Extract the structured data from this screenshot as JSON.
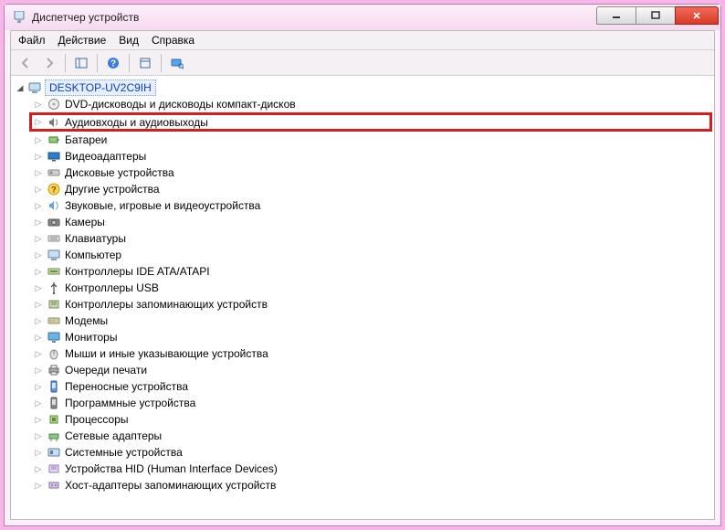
{
  "window": {
    "title": "Диспетчер устройств"
  },
  "menu": {
    "file": "Файл",
    "action": "Действие",
    "view": "Вид",
    "help": "Справка"
  },
  "tree": {
    "root_label": "DESKTOP-UV2C9IH",
    "items": [
      {
        "label": "DVD-дисководы и дисководы компакт-дисков",
        "icon": "disc-icon"
      },
      {
        "label": "Аудиовходы и аудиовыходы",
        "icon": "speaker-icon",
        "highlight": true
      },
      {
        "label": "Батареи",
        "icon": "battery-icon"
      },
      {
        "label": "Видеоадаптеры",
        "icon": "display-adapter-icon"
      },
      {
        "label": "Дисковые устройства",
        "icon": "drive-icon"
      },
      {
        "label": "Другие устройства",
        "icon": "question-icon"
      },
      {
        "label": "Звуковые, игровые и видеоустройства",
        "icon": "sound-icon"
      },
      {
        "label": "Камеры",
        "icon": "camera-icon"
      },
      {
        "label": "Клавиатуры",
        "icon": "keyboard-icon"
      },
      {
        "label": "Компьютер",
        "icon": "computer-icon"
      },
      {
        "label": "Контроллеры IDE ATA/ATAPI",
        "icon": "ide-icon"
      },
      {
        "label": "Контроллеры USB",
        "icon": "usb-icon"
      },
      {
        "label": "Контроллеры запоминающих устройств",
        "icon": "storage-controller-icon"
      },
      {
        "label": "Модемы",
        "icon": "modem-icon"
      },
      {
        "label": "Мониторы",
        "icon": "monitor-icon"
      },
      {
        "label": "Мыши и иные указывающие устройства",
        "icon": "mouse-icon"
      },
      {
        "label": "Очереди печати",
        "icon": "printer-icon"
      },
      {
        "label": "Переносные устройства",
        "icon": "portable-icon"
      },
      {
        "label": "Программные устройства",
        "icon": "software-device-icon"
      },
      {
        "label": "Процессоры",
        "icon": "cpu-icon"
      },
      {
        "label": "Сетевые адаптеры",
        "icon": "network-icon"
      },
      {
        "label": "Системные устройства",
        "icon": "system-device-icon"
      },
      {
        "label": "Устройства HID (Human Interface Devices)",
        "icon": "hid-icon"
      },
      {
        "label": "Хост-адаптеры запоминающих устройств",
        "icon": "host-adapter-icon"
      }
    ]
  }
}
